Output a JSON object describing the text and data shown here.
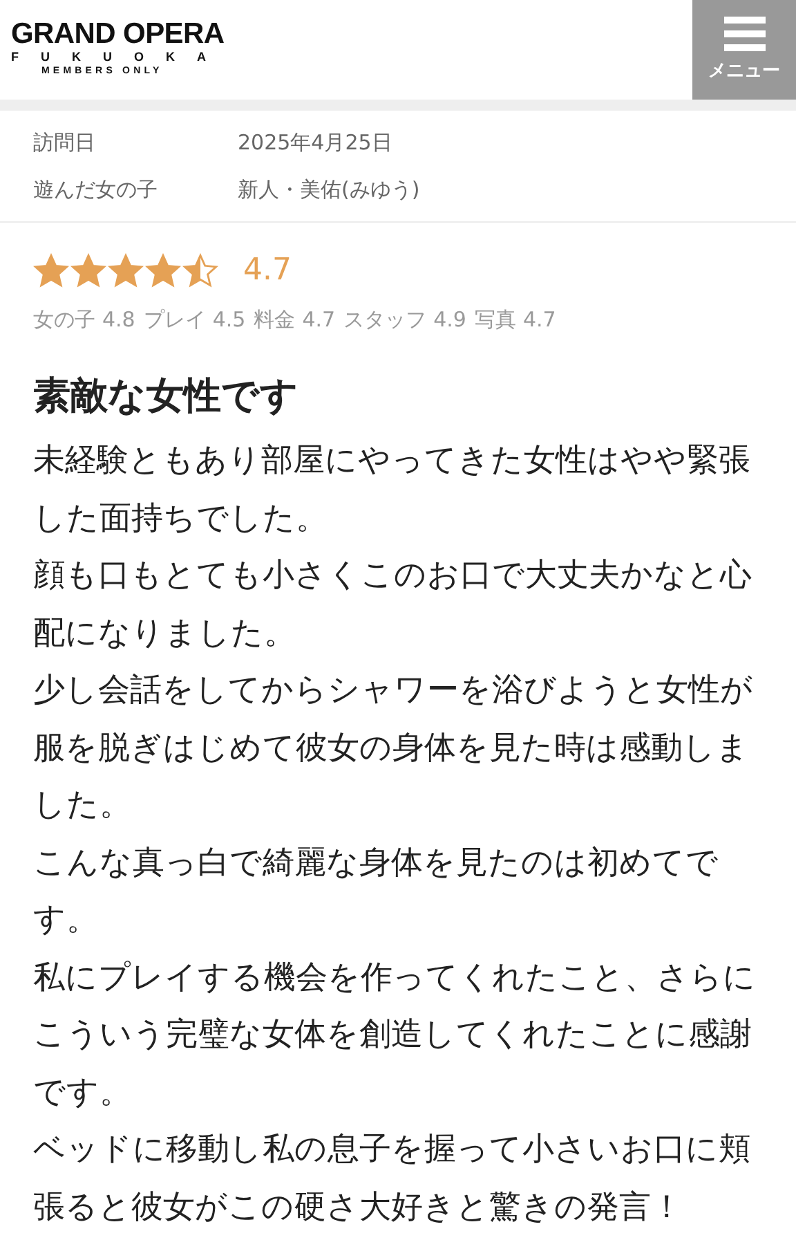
{
  "header": {
    "logo": {
      "title": "GRAND OPERA",
      "city": "FUKUOKA",
      "tagline": "MEMBERS ONLY"
    },
    "menu_button": {
      "label": "メニュー"
    }
  },
  "visit_info": [
    {
      "label": "訪問日",
      "value": "2025年4月25日"
    },
    {
      "label": "遊んだ女の子",
      "value": "新人・美佑(みゆう)"
    }
  ],
  "rating": {
    "stars": 4.5,
    "score": "4.7",
    "breakdown": [
      {
        "label": "女の子",
        "value": "4.8"
      },
      {
        "label": "プレイ",
        "value": "4.5"
      },
      {
        "label": "料金",
        "value": "4.7"
      },
      {
        "label": "スタッフ",
        "value": "4.9"
      },
      {
        "label": "写真",
        "value": "4.7"
      }
    ]
  },
  "review": {
    "title": "素敵な女性です",
    "paragraphs": [
      "未経験ともあり部屋にやってきた女性はやや緊張した面持ちでした。",
      "顔も口もとても小さくこのお口で大丈夫かなと心配になりました。",
      "少し会話をしてからシャワーを浴びようと女性が服を脱ぎはじめて彼女の身体を見た時は感動しました。",
      "こんな真っ白で綺麗な身体を見たのは初めてです。",
      "私にプレイする機会を作ってくれたこと、さらにこういう完璧な女体を創造してくれたことに感謝です。",
      "ベッドに移動し私の息子を握って小さいお口に頬張ると彼女がこの硬さ大好きと驚きの発言！"
    ]
  }
}
